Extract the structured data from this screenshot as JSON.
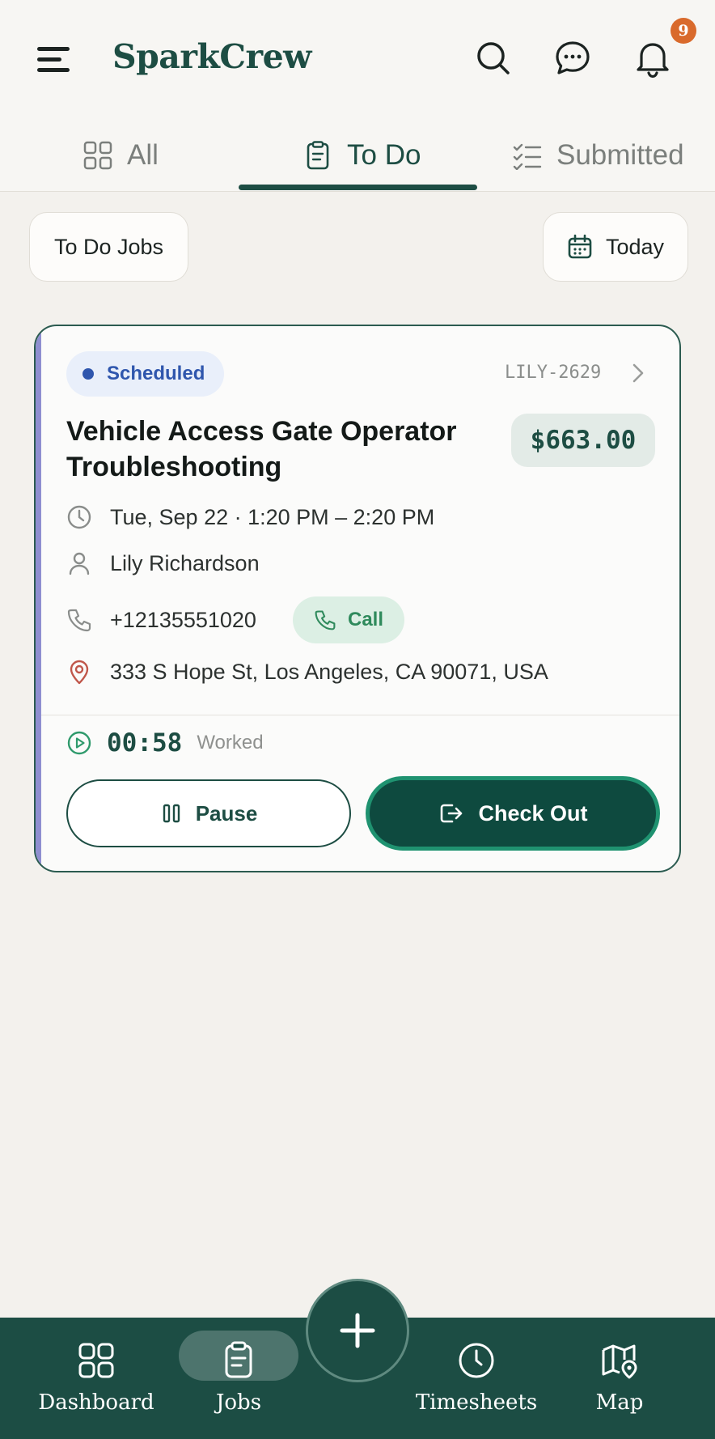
{
  "header": {
    "brand": "SparkCrew",
    "notification_count": "9",
    "icons": [
      "menu-icon",
      "search-icon",
      "chat-icon",
      "bell-icon"
    ]
  },
  "tabs": [
    {
      "label": "All",
      "icon": "grid-icon",
      "active": false
    },
    {
      "label": "To Do",
      "icon": "clipboard-icon",
      "active": true
    },
    {
      "label": "Submitted",
      "icon": "checklist-icon",
      "active": false
    }
  ],
  "filters": {
    "jobs_label": "To Do Jobs",
    "date_label": "Today",
    "date_icon": "calendar-icon"
  },
  "job": {
    "status": "Scheduled",
    "id": "LILY-2629",
    "title": "Vehicle Access Gate Operator Troubleshooting",
    "price": "$663.00",
    "datetime": "Tue, Sep 22 · 1:20 PM – 2:20 PM",
    "customer": "Lily Richardson",
    "phone": "+12135551020",
    "call_label": "Call",
    "address": "333 S Hope St, Los Angeles, CA 90071, USA",
    "timer": "00:58",
    "timer_label": "Worked",
    "pause_label": "Pause",
    "checkout_label": "Check Out"
  },
  "bottom_nav": {
    "items": [
      {
        "label": "Dashboard",
        "icon": "dashboard-icon"
      },
      {
        "label": "Jobs",
        "icon": "clipboard-icon",
        "active": true
      },
      {
        "label": "Timesheets",
        "icon": "clock-icon"
      },
      {
        "label": "Map",
        "icon": "map-icon"
      }
    ],
    "fab_icon": "plus-icon"
  },
  "colors": {
    "brand": "#1d4d43",
    "nav_bg": "#1c4d44",
    "status_blue": "#2f56ad",
    "call_green": "#2f8a5c",
    "badge": "#d96a2c"
  }
}
